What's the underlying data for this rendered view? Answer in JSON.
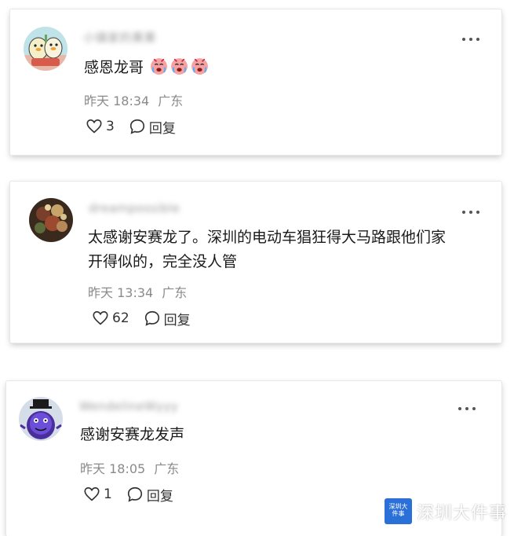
{
  "comments": [
    {
      "username": "小镇家的果果",
      "avatar_icon": "cartoon-duck-avatar-icon",
      "content": "感恩龙哥",
      "emojis": [
        "crying-face-icon",
        "crying-face-icon",
        "crying-face-icon"
      ],
      "time": "昨天 18:34",
      "location": "广东",
      "likes": "3",
      "reply_label": "回复"
    },
    {
      "username": "dreampossible",
      "avatar_icon": "flower-painting-avatar-icon",
      "content_lines": [
        "太感谢安赛龙了。深圳的电动车猖狂得大马路跟他们家",
        "开得似的，完全没人管"
      ],
      "time": "昨天 13:34",
      "location": "广东",
      "likes": "62",
      "reply_label": "回复"
    },
    {
      "username": "WendelineWyyy",
      "avatar_icon": "purple-monster-avatar-icon",
      "content": "感谢安赛龙发声",
      "time": "昨天 18:05",
      "location": "广东",
      "likes": "1",
      "reply_label": "回复"
    }
  ],
  "watermark": {
    "logo_text": "深圳大件事",
    "text": "深圳大件事"
  },
  "colors": {
    "meta_gray": "#8a8a8a",
    "watermark_blue": "#2b6fd8"
  }
}
